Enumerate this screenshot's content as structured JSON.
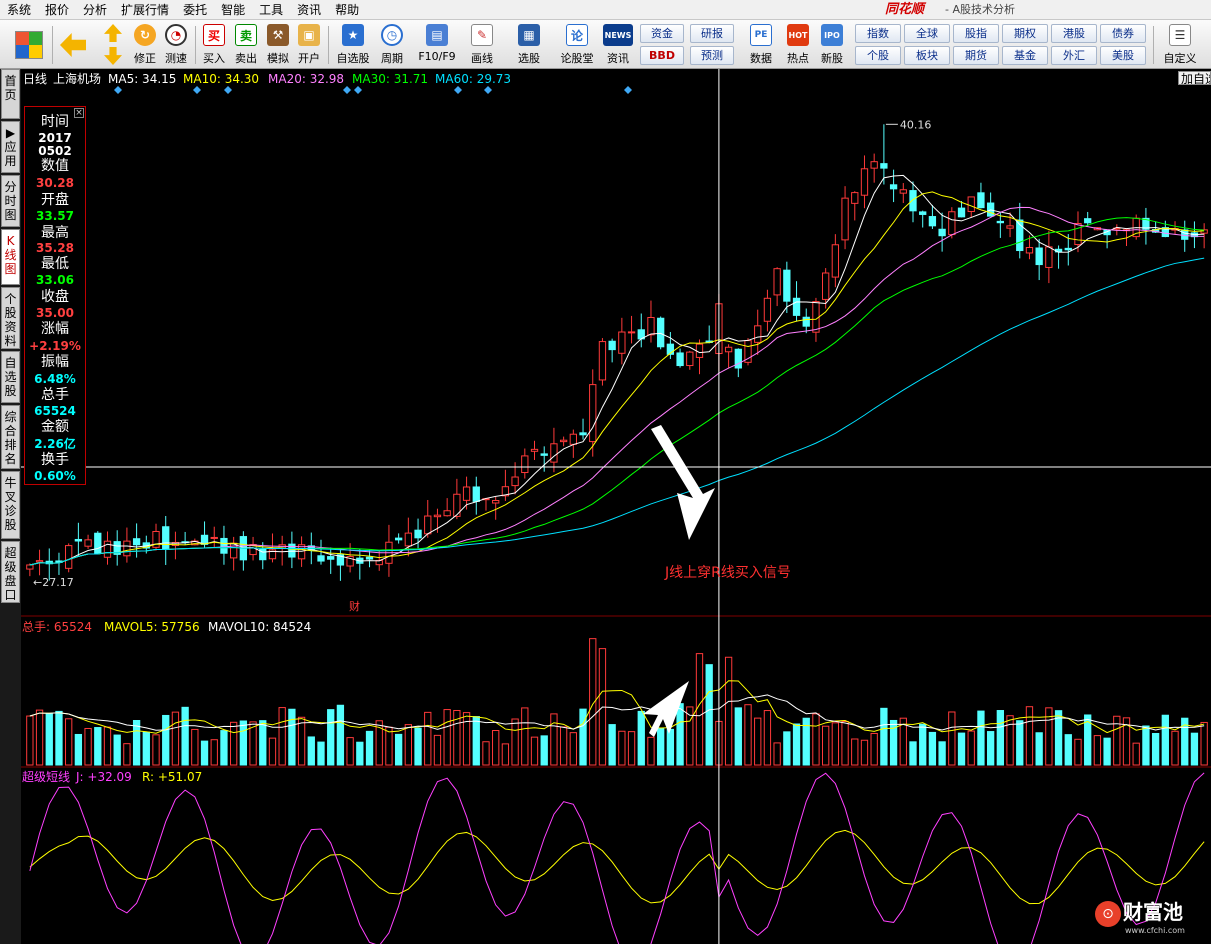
{
  "app": {
    "brand": "同花顺",
    "title": "- A股技术分析",
    "menu": [
      "系统",
      "报价",
      "分析",
      "扩展行情",
      "委托",
      "智能",
      "工具",
      "资讯",
      "帮助"
    ]
  },
  "toolbar": {
    "buttons": [
      "修正",
      "测速",
      "买入",
      "卖出",
      "模拟",
      "开户",
      "自选股",
      "周期",
      "F10/F9",
      "画线",
      "选股",
      "论股堂",
      "资讯",
      "数据",
      "热点",
      "新股",
      "自定义"
    ],
    "grid": [
      "资金",
      "研报",
      "BBD",
      "预测",
      "指数",
      "全球",
      "股指",
      "期权",
      "港股",
      "债券",
      "个股",
      "板块",
      "期货",
      "基金",
      "外汇",
      "美股"
    ],
    "icon_text": {
      "buy": "买",
      "sell": "卖",
      "news": "NEWS",
      "pe": "PE",
      "lun": "论",
      "ipo": "IPO",
      "hot": "HOT"
    }
  },
  "sidetabs": [
    "首\n页",
    "▶\n应\n用",
    "分\n时\n图",
    "K\n线\n图",
    "个\n股\n资\n料",
    "自\n选\n股",
    "综\n合\n排\n名",
    "牛\n叉\n诊\n股",
    "超\n级\n盘\n口"
  ],
  "kline": {
    "period": "日线",
    "stock": "上海机场",
    "ma": [
      {
        "label": "MA5: 34.15",
        "color": "#ffffff"
      },
      {
        "label": "MA10: 34.30",
        "color": "#ffff00"
      },
      {
        "label": "MA20: 32.98",
        "color": "#ff80ff"
      },
      {
        "label": "MA30: 31.71",
        "color": "#00ff00"
      },
      {
        "label": "MA60: 29.73",
        "color": "#00e0ff"
      }
    ],
    "high_label": "40.16",
    "low_label": "27.17",
    "fin_marker": "财",
    "add_button": "加自选"
  },
  "pricebox": {
    "labels": [
      "时间",
      "数值",
      "开盘",
      "最高",
      "最低",
      "收盘",
      "涨幅",
      "振幅",
      "总手",
      "金额",
      "换手"
    ],
    "values": [
      "2017",
      "0502",
      "30.28",
      "33.57",
      "35.28",
      "33.06",
      "35.00",
      "+2.19%",
      "6.48%",
      "65524",
      "2.26亿",
      "0.60%"
    ],
    "value_colors": [
      "#ffffff",
      "#ffffff",
      "#ff4040",
      "#00ff00",
      "#ff4040",
      "#00ff00",
      "#ff4040",
      "#ff4040",
      "#00ffff",
      "#00ffff",
      "#00ffff",
      "#00ffff"
    ]
  },
  "volume": {
    "label": "总手: 65524",
    "mavol5": "MAVOL5: 57756",
    "mavol10": "MAVOL10: 84524"
  },
  "indicator": {
    "name": "超级短线",
    "j": "J: +32.09",
    "r": "R: +51.07"
  },
  "annotation": {
    "text": "J线上穿R线买入信号"
  },
  "watermark": {
    "text": "财富池",
    "url": "www.cfchi.com"
  },
  "chart_data": {
    "type": "candlestick",
    "stock": "上海机场",
    "period": "日线",
    "price_range": [
      27.17,
      40.16
    ],
    "cursor": {
      "date": "20170502",
      "open": 33.57,
      "high": 35.28,
      "low": 33.06,
      "close": 35.0,
      "change_pct": 2.19,
      "amplitude_pct": 6.48,
      "volume": 65524,
      "turnover": "2.26亿",
      "turnover_rate_pct": 0.6
    },
    "ma_last": {
      "MA5": 34.15,
      "MA10": 34.3,
      "MA20": 32.98,
      "MA30": 31.71,
      "MA60": 29.73
    },
    "volume_last": {
      "volume": 65524,
      "MAVOL5": 57756,
      "MAVOL10": 84524
    },
    "indicator_last": {
      "J": 32.09,
      "R": 51.07
    }
  }
}
